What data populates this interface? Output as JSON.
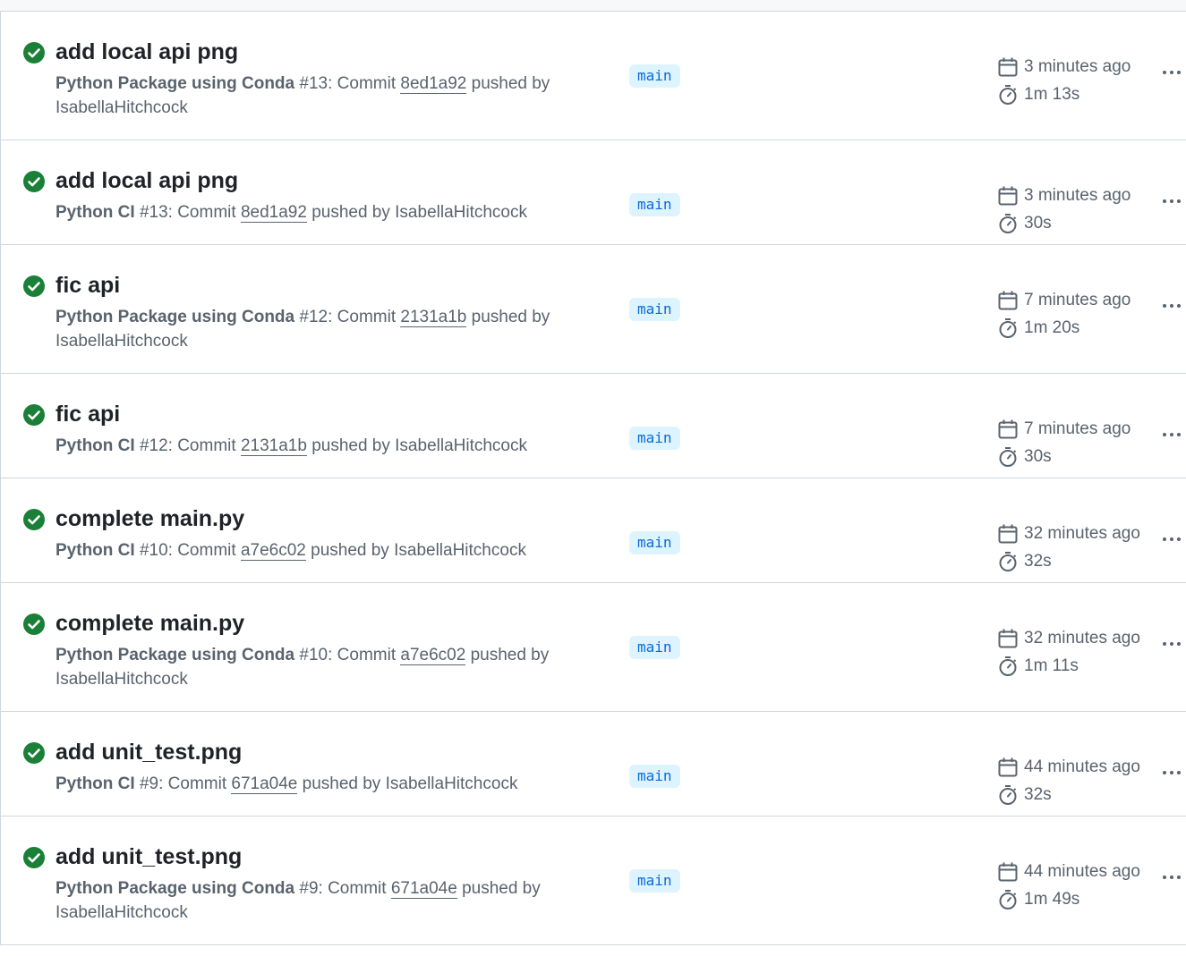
{
  "runs": [
    {
      "title": "add local api png",
      "workflow": "Python Package using Conda",
      "run_number": "#13",
      "commit_prefix": ": Commit",
      "sha": "8ed1a92",
      "pushed_by_text": "pushed by",
      "user": "IsabellaHitchcock",
      "branch": "main",
      "age": "3 minutes ago",
      "duration": "1m 13s",
      "status": "success"
    },
    {
      "title": "add local api png",
      "workflow": "Python CI",
      "run_number": "#13",
      "commit_prefix": ": Commit",
      "sha": "8ed1a92",
      "pushed_by_text": "pushed by",
      "user": "IsabellaHitchcock",
      "branch": "main",
      "age": "3 minutes ago",
      "duration": "30s",
      "status": "success"
    },
    {
      "title": "fic api",
      "workflow": "Python Package using Conda",
      "run_number": "#12",
      "commit_prefix": ": Commit",
      "sha": "2131a1b",
      "pushed_by_text": "pushed by",
      "user": "IsabellaHitchcock",
      "branch": "main",
      "age": "7 minutes ago",
      "duration": "1m 20s",
      "status": "success"
    },
    {
      "title": "fic api",
      "workflow": "Python CI",
      "run_number": "#12",
      "commit_prefix": ": Commit",
      "sha": "2131a1b",
      "pushed_by_text": "pushed by",
      "user": "IsabellaHitchcock",
      "branch": "main",
      "age": "7 minutes ago",
      "duration": "30s",
      "status": "success"
    },
    {
      "title": "complete main.py",
      "workflow": "Python CI",
      "run_number": "#10",
      "commit_prefix": ": Commit",
      "sha": "a7e6c02",
      "pushed_by_text": "pushed by",
      "user": "IsabellaHitchcock",
      "branch": "main",
      "age": "32 minutes ago",
      "duration": "32s",
      "status": "success"
    },
    {
      "title": "complete main.py",
      "workflow": "Python Package using Conda",
      "run_number": "#10",
      "commit_prefix": ": Commit",
      "sha": "a7e6c02",
      "pushed_by_text": "pushed by",
      "user": "IsabellaHitchcock",
      "branch": "main",
      "age": "32 minutes ago",
      "duration": "1m 11s",
      "status": "success"
    },
    {
      "title": "add unit_test.png",
      "workflow": "Python CI",
      "run_number": "#9",
      "commit_prefix": ": Commit",
      "sha": "671a04e",
      "pushed_by_text": "pushed by",
      "user": "IsabellaHitchcock",
      "branch": "main",
      "age": "44 minutes ago",
      "duration": "32s",
      "status": "success"
    },
    {
      "title": "add unit_test.png",
      "workflow": "Python Package using Conda",
      "run_number": "#9",
      "commit_prefix": ": Commit",
      "sha": "671a04e",
      "pushed_by_text": "pushed by",
      "user": "IsabellaHitchcock",
      "branch": "main",
      "age": "44 minutes ago",
      "duration": "1m 49s",
      "status": "success"
    }
  ],
  "icons": {
    "status": "check-circle-icon",
    "age": "calendar-icon",
    "duration": "stopwatch-icon",
    "menu": "kebab-menu-icon"
  },
  "colors": {
    "success": "#1a7f37",
    "branch_bg": "#ddf4ff",
    "branch_fg": "#0969da",
    "muted": "#59636e",
    "border": "#d0d7de"
  }
}
